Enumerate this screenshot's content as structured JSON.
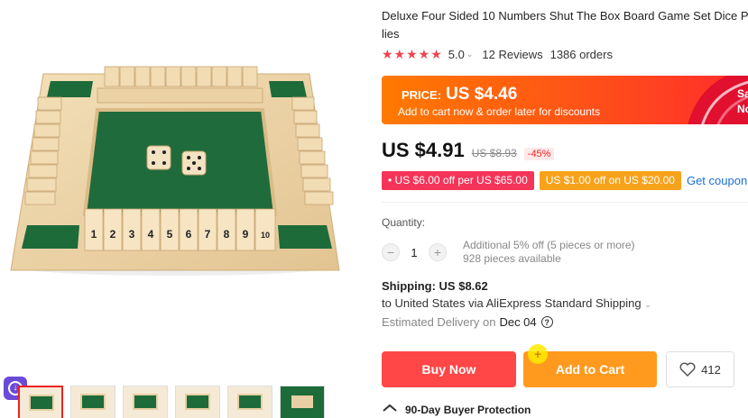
{
  "product": {
    "title": "Deluxe Four Sided 10 Numbers Shut The Box Board Game Set Dice Pa lies",
    "rating": "5.0",
    "reviews": "12 Reviews",
    "orders": "1386 orders"
  },
  "board_numbers": [
    "1",
    "2",
    "3",
    "4",
    "5",
    "6",
    "7",
    "8",
    "9",
    "10"
  ],
  "promo": {
    "label": "PRICE:",
    "price": "US $4.46",
    "subtitle": "Add to cart now & order later for discounts",
    "side_text_1": "Sa",
    "side_text_2": "No"
  },
  "pricing": {
    "current": "US $4.91",
    "original": "US $8.93",
    "discount": "-45%"
  },
  "coupons": {
    "store_coupon": "• US $6.00 off per US $65.00",
    "select_coupon": "US $1.00 off on US $20.00",
    "get_coupons": "Get coupon"
  },
  "quantity": {
    "label": "Quantity:",
    "minus": "−",
    "value": "1",
    "plus": "+",
    "additional": "Additional 5% off (5 pieces or more)",
    "available": "928 pieces available"
  },
  "shipping": {
    "title": "Shipping: US $8.62",
    "line": "to United States via AliExpress Standard Shipping",
    "delivery_label": "Estimated Delivery on",
    "delivery_date": "Dec 04"
  },
  "actions": {
    "buy_now": "Buy Now",
    "add_to_cart": "Add to Cart",
    "wishlist_count": "412"
  },
  "protection": "90-Day Buyer Protection",
  "colors": {
    "accent_red": "#ff4747",
    "accent_orange": "#ff9a1f",
    "star": "#f0434e",
    "link": "#1b6fd6"
  }
}
